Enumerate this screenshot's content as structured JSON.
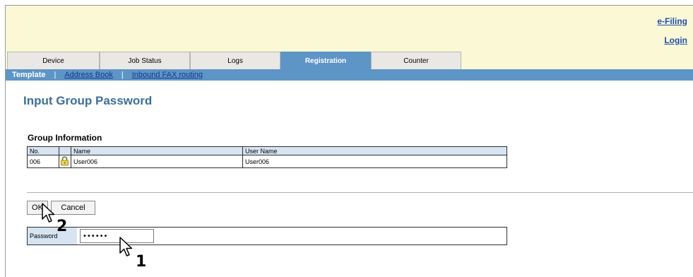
{
  "header": {
    "efiling_link": "e-Filing",
    "login_link": "Login"
  },
  "tabs": [
    {
      "label": "Device",
      "active": false
    },
    {
      "label": "Job Status",
      "active": false
    },
    {
      "label": "Logs",
      "active": false
    },
    {
      "label": "Registration",
      "active": true
    },
    {
      "label": "Counter",
      "active": false
    }
  ],
  "subnav": {
    "items": [
      {
        "label": "Template",
        "current": true
      },
      {
        "label": "Address Book",
        "current": false
      },
      {
        "label": "Inbound FAX routing",
        "current": false
      }
    ],
    "separator": "|"
  },
  "page": {
    "title": "Input Group Password",
    "section_title": "Group Information"
  },
  "group_table": {
    "headers": [
      "No.",
      "",
      "Name",
      "User Name"
    ],
    "rows": [
      {
        "no": "006",
        "icon": "lock-icon",
        "name": "User006",
        "user_name": "User006"
      }
    ]
  },
  "buttons": {
    "ok": "OK",
    "cancel": "Cancel"
  },
  "password": {
    "label": "Password",
    "value": "••••••"
  },
  "annotations": {
    "step1": "1",
    "step2": "2"
  },
  "colors": {
    "header_bg": "#fbf8d6",
    "accent_blue": "#5d95c6",
    "title_blue": "#3d6f9c",
    "link_blue": "#1b4fb0",
    "table_header_bg": "#d6e4f1"
  }
}
